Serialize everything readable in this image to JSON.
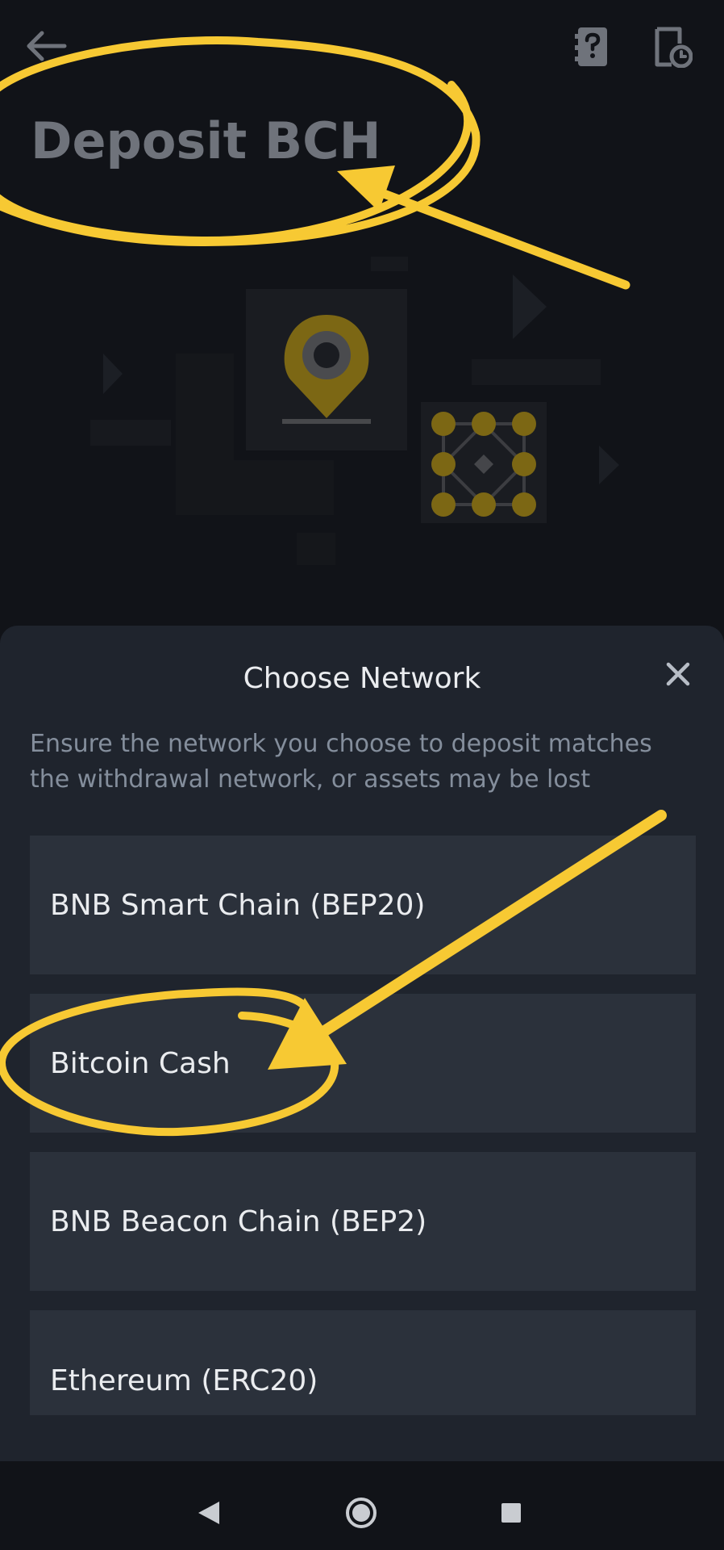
{
  "header": {
    "title": "Deposit BCH",
    "back_icon": "arrow-left-icon",
    "help_icon": "question-book-icon",
    "history_icon": "document-clock-icon"
  },
  "sheet": {
    "title": "Choose Network",
    "description": "Ensure the network you choose to deposit matches the withdrawal network, or assets may be lost",
    "networks": [
      {
        "label": "BNB Smart Chain (BEP20)"
      },
      {
        "label": "Bitcoin Cash"
      },
      {
        "label": "BNB Beacon Chain (BEP2)"
      },
      {
        "label": "Ethereum (ERC20)"
      }
    ]
  },
  "system_nav": {
    "back": "triangle-back-icon",
    "home": "circle-home-icon",
    "recents": "square-recents-icon"
  },
  "colors": {
    "background": "#111318",
    "sheet": "#1f242d",
    "option": "#2b313b",
    "accent": "#f0b90b",
    "annotation": "#f7c933"
  }
}
